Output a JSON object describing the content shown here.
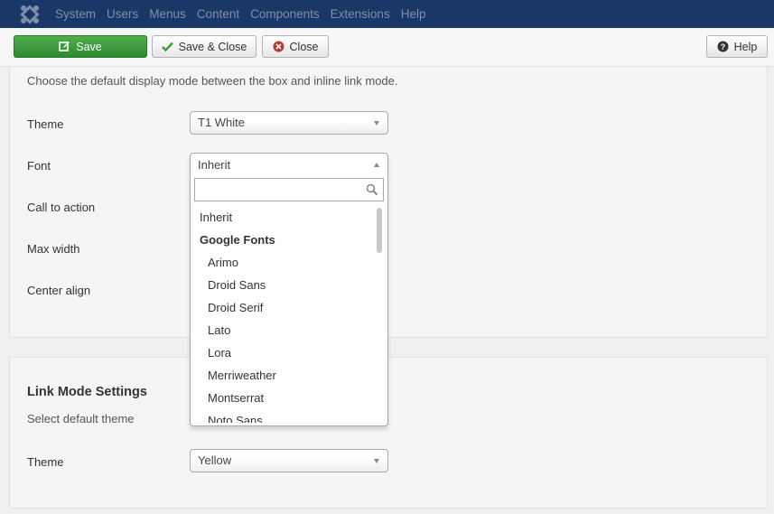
{
  "nav": {
    "menu": [
      "System",
      "Users",
      "Menus",
      "Content",
      "Components",
      "Extensions",
      "Help"
    ]
  },
  "toolbar": {
    "save": "Save",
    "save_close": "Save & Close",
    "close": "Close",
    "help": "Help"
  },
  "box_settings": {
    "description": "Choose the default display mode between the box and inline link mode.",
    "theme_label": "Theme",
    "theme_value": "T1 White",
    "font_label": "Font",
    "font_value": "Inherit",
    "cta_label": "Call to action",
    "maxwidth_label": "Max width",
    "center_label": "Center align"
  },
  "font_dropdown": {
    "search_placeholder": "",
    "options": [
      {
        "label": "Inherit",
        "kind": "option"
      },
      {
        "label": "Google Fonts",
        "kind": "group"
      },
      {
        "label": "Arimo",
        "kind": "sub"
      },
      {
        "label": "Droid Sans",
        "kind": "sub"
      },
      {
        "label": "Droid Serif",
        "kind": "sub"
      },
      {
        "label": "Lato",
        "kind": "sub"
      },
      {
        "label": "Lora",
        "kind": "sub"
      },
      {
        "label": "Merriweather",
        "kind": "sub"
      },
      {
        "label": "Montserrat",
        "kind": "sub"
      },
      {
        "label": "Noto Sans",
        "kind": "sub"
      }
    ]
  },
  "link_mode": {
    "heading": "Link Mode Settings",
    "description": "Select default theme",
    "theme_label": "Theme",
    "theme_value": "Yellow"
  },
  "colors": {
    "nav_bg": "#1a3867",
    "save_green": "#3d9b3c",
    "close_red": "#b73a2c"
  }
}
